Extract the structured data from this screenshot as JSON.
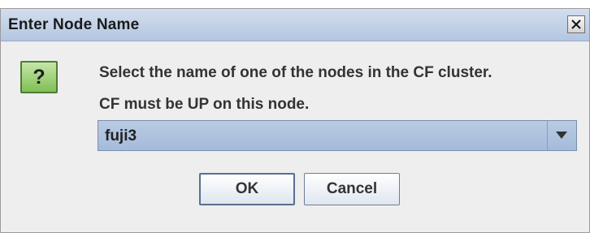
{
  "window": {
    "title": "Enter Node Name"
  },
  "message": {
    "line1": "Select the name of one of the nodes in the CF cluster.",
    "line2": "CF must be UP on this node."
  },
  "node_select": {
    "selected": "fuji3"
  },
  "buttons": {
    "ok": "OK",
    "cancel": "Cancel"
  },
  "icons": {
    "help": "question-icon",
    "close": "close-icon",
    "dropdown": "chevron-down-icon"
  },
  "help_glyph": "?"
}
